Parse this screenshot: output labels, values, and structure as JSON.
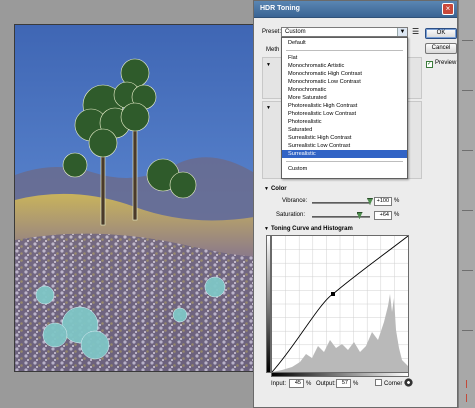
{
  "dialog": {
    "title": "HDR Toning",
    "close_glyph": "×",
    "preset_label": "Preset:",
    "preset_value": "Custom",
    "preset_arrow": "▼",
    "preset_menu_icon": "☰",
    "buttons": {
      "ok": "OK",
      "cancel": "Cancel",
      "load": "Load..."
    },
    "preview_label": "Preview",
    "preview_checked": true,
    "preview_check_glyph": "✓",
    "method_fragment": "Meth"
  },
  "preset_dropdown": {
    "items": [
      "Default",
      "",
      "Flat",
      "Monochromatic Artistic",
      "Monochromatic High Contrast",
      "Monochromatic Low Contrast",
      "Monochromatic",
      "More Saturated",
      "Photorealistic High Contrast",
      "Photorealistic Low Contrast",
      "Photorealistic",
      "Saturated",
      "Surrealistic High Contrast",
      "Surrealistic Low Contrast",
      "Surrealistic",
      "",
      "Custom"
    ],
    "selected": "Surrealistic"
  },
  "color_section": {
    "title": "Color",
    "triangle": "▼",
    "vibrance_label": "Vibrance:",
    "vibrance_value": "+100",
    "vibrance_level": 1.0,
    "saturation_label": "Saturation:",
    "saturation_value": "+64",
    "saturation_level": 0.82,
    "percent": "%"
  },
  "curve_section": {
    "title": "Toning Curve and Histogram",
    "triangle": "▼",
    "input_label": "Input:",
    "input_value": "45",
    "output_label": "Output:",
    "output_value": "57",
    "percent": "%",
    "corner_label": "Corner",
    "corner_checked": false
  },
  "icons": [
    "close-icon",
    "preset-options-icon",
    "reset-curve-icon"
  ],
  "colors": {
    "title_bar": "#3a6494",
    "selection": "#3163c5",
    "dialog_bg": "#ececec"
  }
}
